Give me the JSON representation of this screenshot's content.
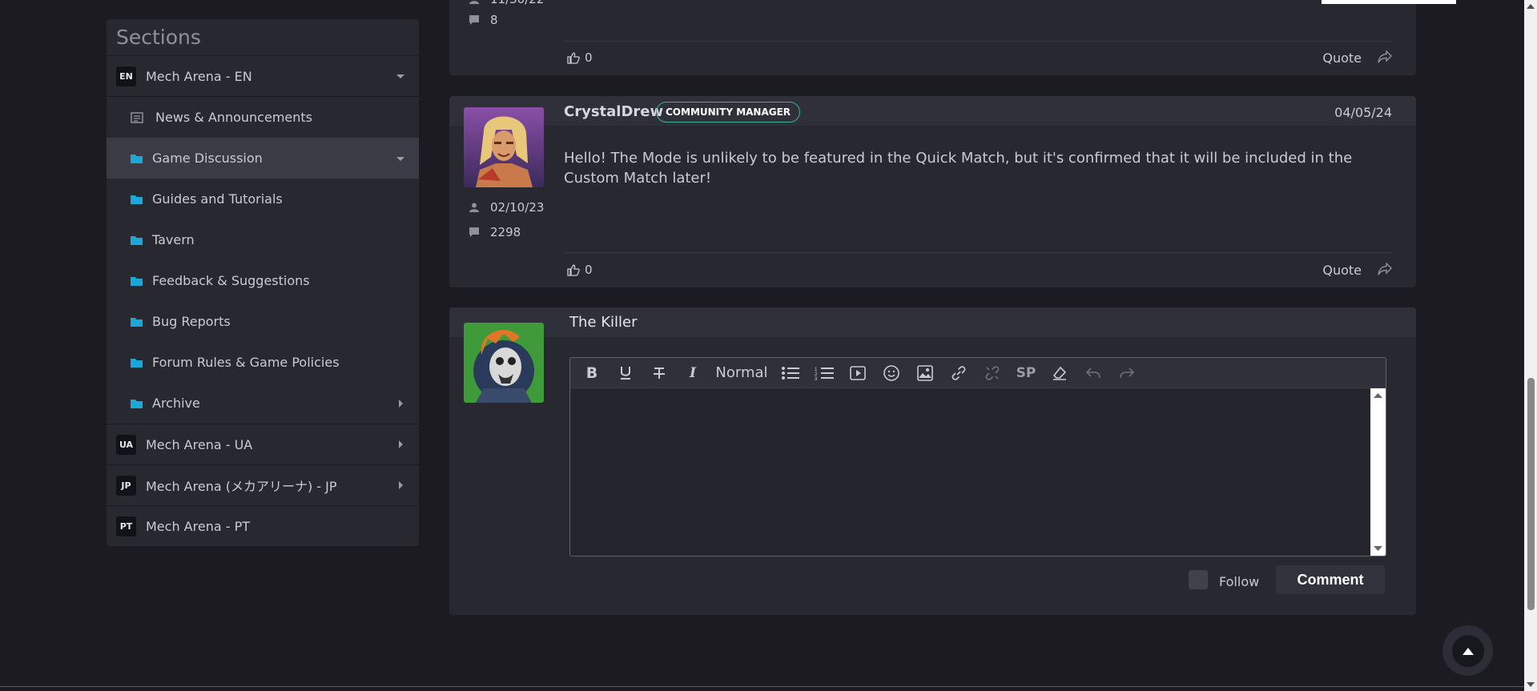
{
  "sidebar": {
    "title": "Sections",
    "sites": [
      {
        "code": "EN",
        "label": "Mech Arena - EN"
      },
      {
        "code": "UA",
        "label": "Mech Arena - UA"
      },
      {
        "code": "JP",
        "label": "Mech Arena (メカアリーナ) - JP"
      },
      {
        "code": "PT",
        "label": "Mech Arena - PT"
      }
    ],
    "sections": [
      {
        "label": "News & Announcements",
        "icon": "news-icon"
      },
      {
        "label": "Game Discussion",
        "icon": "folder-icon",
        "active": true
      },
      {
        "label": "Guides and Tutorials",
        "icon": "folder-icon"
      },
      {
        "label": "Tavern",
        "icon": "folder-icon"
      },
      {
        "label": "Feedback & Suggestions",
        "icon": "folder-icon"
      },
      {
        "label": "Bug Reports",
        "icon": "folder-icon"
      },
      {
        "label": "Forum Rules & Game Policies",
        "icon": "folder-icon"
      },
      {
        "label": "Archive",
        "icon": "folder-icon"
      }
    ]
  },
  "posts": [
    {
      "partial": true,
      "join_date": "11/30/22",
      "post_count": "8",
      "likes": "0",
      "quote_label": "Quote"
    },
    {
      "author": "CrystalDrew",
      "role": "COMMUNITY MANAGER",
      "date": "04/05/24",
      "join_date": "02/10/23",
      "post_count": "2298",
      "body": "Hello! The Mode is unlikely to be featured in the Quick Match, but it's confirmed that it will be included in the Custom Match later!",
      "likes": "0",
      "quote_label": "Quote"
    }
  ],
  "reply": {
    "author": "The Killer",
    "toolbar": {
      "header_select": "Normal",
      "sp_label": "SP"
    },
    "follow_label": "Follow",
    "comment_label": "Comment"
  },
  "colors": {
    "background": "#1b1b21",
    "card": "#272830",
    "accent": "#1ba7d8",
    "role_badge_border": "#3fb58d"
  }
}
